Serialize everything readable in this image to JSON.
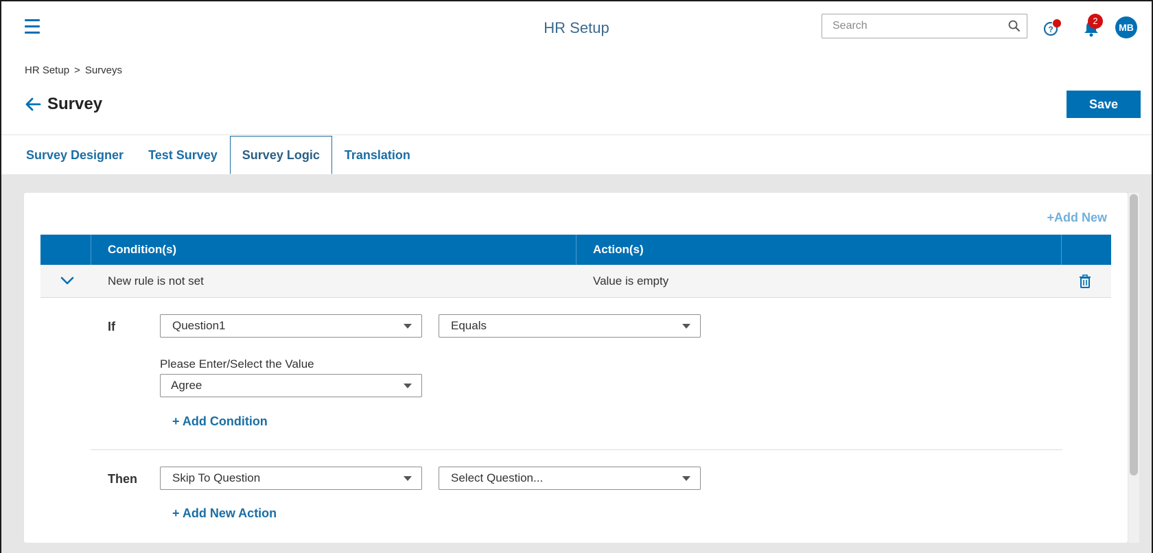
{
  "app": {
    "title": "HR Setup"
  },
  "search": {
    "placeholder": "Search"
  },
  "notifications": {
    "count": "2"
  },
  "user": {
    "initials": "MB"
  },
  "breadcrumb": {
    "items": [
      "HR Setup",
      "Surveys"
    ],
    "separator": ">"
  },
  "page": {
    "title": "Survey",
    "save_label": "Save"
  },
  "tabs": [
    {
      "label": "Survey Designer",
      "active": false
    },
    {
      "label": "Test Survey",
      "active": false
    },
    {
      "label": "Survey Logic",
      "active": true
    },
    {
      "label": "Translation",
      "active": false
    }
  ],
  "logic": {
    "add_new_label": "Add New",
    "columns": {
      "conditions": "Condition(s)",
      "actions": "Action(s)"
    },
    "rule": {
      "condition_summary": "New rule is not set",
      "action_summary": "Value is empty"
    },
    "if_label": "If",
    "then_label": "Then",
    "condition": {
      "question": "Question1",
      "operator": "Equals",
      "value_label": "Please Enter/Select the Value",
      "value": "Agree"
    },
    "add_condition_label": "+ Add Condition",
    "action": {
      "type": "Skip To Question",
      "target_placeholder": "Select Question..."
    },
    "add_action_label": "+ Add New Action"
  },
  "colors": {
    "primary": "#0070b4",
    "badge": "#d21010",
    "background": "#e6e6e6"
  },
  "icons": [
    "menu-icon",
    "search-icon",
    "help-icon",
    "bell-icon",
    "back-arrow-icon",
    "plus-icon",
    "chevron-down-icon",
    "trash-icon",
    "caret-down-icon"
  ]
}
